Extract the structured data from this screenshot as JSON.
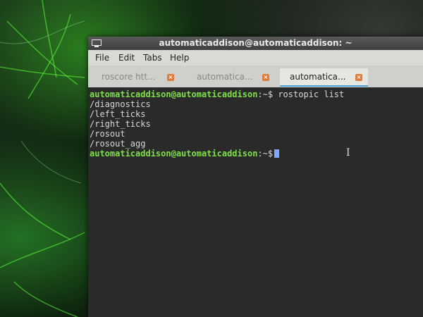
{
  "window": {
    "title": "automaticaddison@automaticaddison: ~"
  },
  "menubar": {
    "items": [
      "File",
      "Edit",
      "Tabs",
      "Help"
    ]
  },
  "tabs": [
    {
      "label": "roscore htt...",
      "active": false
    },
    {
      "label": "automatica...",
      "active": false
    },
    {
      "label": "automatica...",
      "active": true
    }
  ],
  "terminal": {
    "prompt": "automaticaddison@automaticaddison",
    "path_suffix": ":~$",
    "command": " rostopic list",
    "output": [
      "/diagnostics",
      "/left_ticks",
      "/right_ticks",
      "/rosout",
      "/rosout_agg"
    ]
  },
  "colors": {
    "prompt": "#7fe04a",
    "terminal_bg": "#2a2a2a",
    "tab_close": "#e07a3a"
  }
}
